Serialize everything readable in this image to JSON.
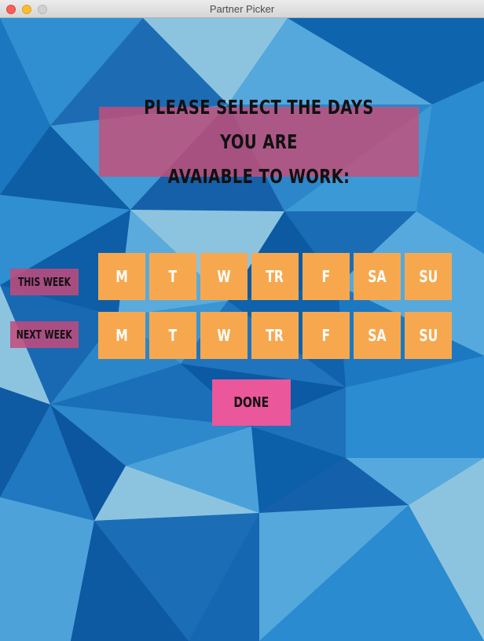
{
  "window": {
    "title": "Partner Picker"
  },
  "heading": {
    "text": "PLEASE SELECT THE DAYS YOU ARE\nAVAIABLE TO WORK:"
  },
  "weeks": [
    {
      "label": "THIS WEEK",
      "days": [
        "M",
        "T",
        "W",
        "TR",
        "F",
        "SA",
        "SU"
      ]
    },
    {
      "label": "NEXT WEEK",
      "days": [
        "M",
        "T",
        "W",
        "TR",
        "F",
        "SA",
        "SU"
      ]
    }
  ],
  "done_button": {
    "label": "DONE"
  },
  "colors": {
    "heading_bg": "#c84e78",
    "week_label_bg": "#c44a7a",
    "day_button_bg": "#f7a84e",
    "done_button_bg": "#ea579a",
    "background": "#1a6fb8"
  }
}
